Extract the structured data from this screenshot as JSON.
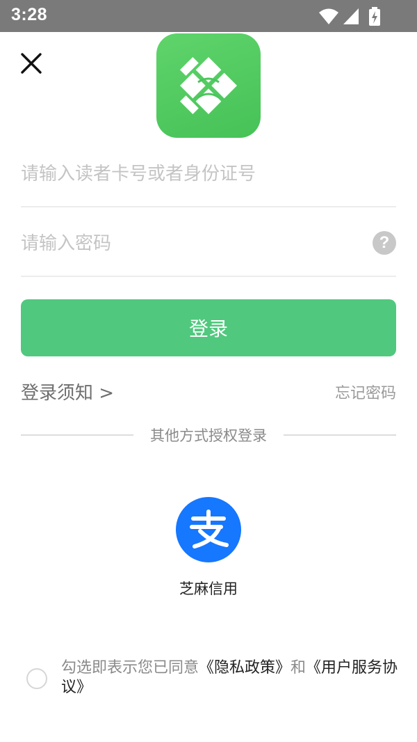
{
  "status_bar": {
    "time": "3:28",
    "icons": [
      "wifi-icon",
      "cellular-signal-icon",
      "battery-charging-icon"
    ]
  },
  "header": {
    "close_icon": "close-icon",
    "logo_icon": "library-app-logo"
  },
  "form": {
    "account_placeholder": "请输入读者卡号或者身份证号",
    "account_value": "",
    "password_placeholder": "请输入密码",
    "password_value": "",
    "help_glyph": "?",
    "login_label": "登录"
  },
  "links": {
    "login_notice": "登录须知 >",
    "forgot_password": "忘记密码"
  },
  "other_login": {
    "divider_text": "其他方式授权登录",
    "alipay_label": "芝麻信用"
  },
  "agreement": {
    "prefix": "勾选即表示您已同意",
    "privacy_policy": "《隐私政策》",
    "conjunction": "和",
    "user_agreement": "《用户服务协议》"
  },
  "colors": {
    "primary_green": "#50c87e",
    "status_bar": "#7a7a7a",
    "alipay_blue": "#1677ff"
  }
}
